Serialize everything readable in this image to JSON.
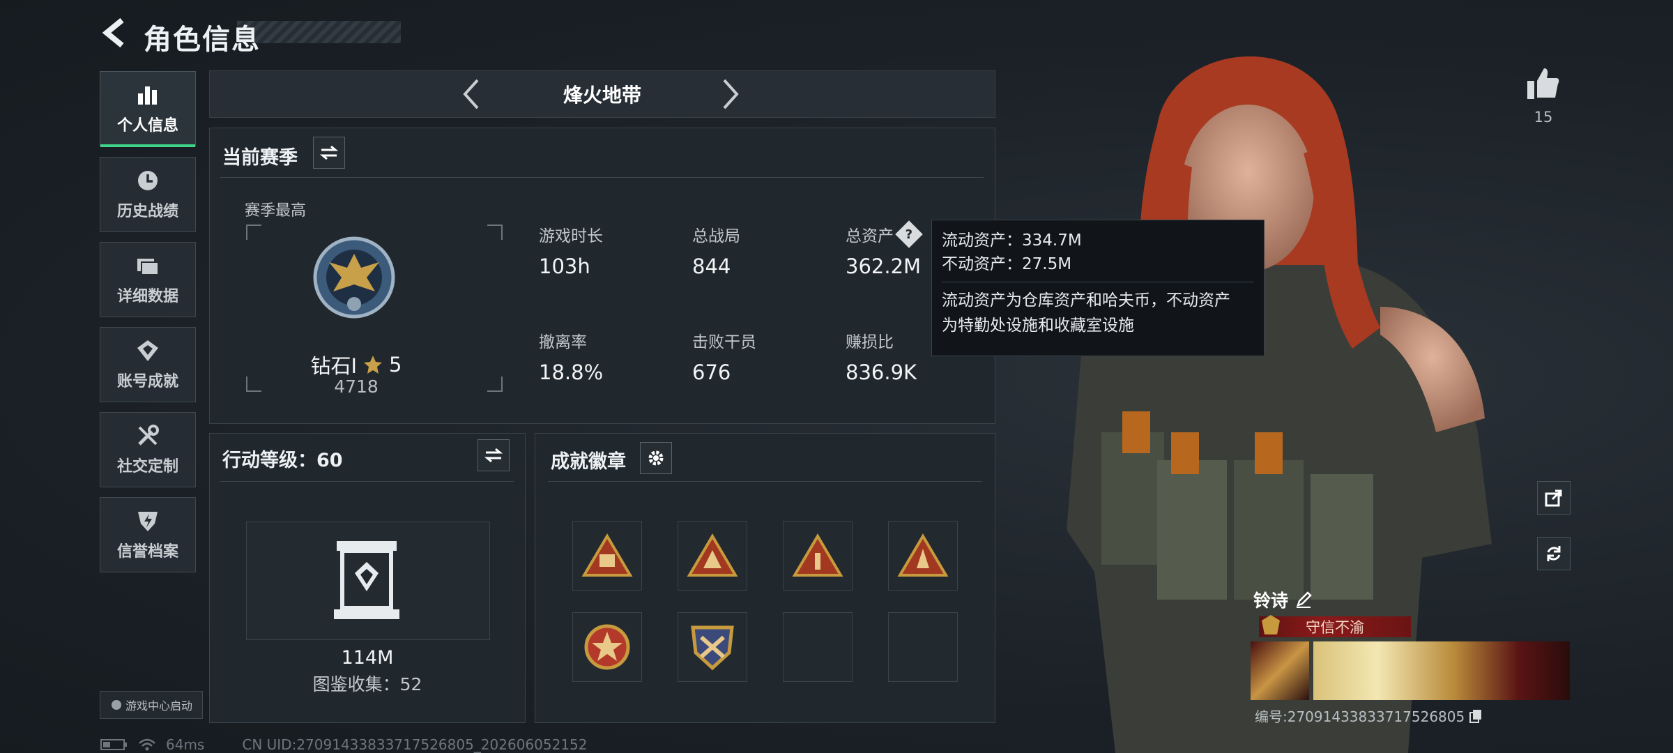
{
  "header": {
    "title": "角色信息"
  },
  "sidebar": {
    "items": [
      {
        "label": "个人信息",
        "icon": "bar-chart-icon",
        "active": true
      },
      {
        "label": "历史战绩",
        "icon": "history-clock-icon",
        "active": false
      },
      {
        "label": "详细数据",
        "icon": "folder-icon",
        "active": false
      },
      {
        "label": "账号成就",
        "icon": "trophy-icon",
        "active": false
      },
      {
        "label": "社交定制",
        "icon": "wrench-icon",
        "active": false
      },
      {
        "label": "信誉档案",
        "icon": "shield-icon",
        "active": false
      }
    ],
    "game_center_label": "游戏中心启动"
  },
  "mode": {
    "title": "烽火地带"
  },
  "season": {
    "title": "当前赛季",
    "best_label": "赛季最高",
    "rank_name": "钻石I",
    "rank_stars": "5",
    "rank_points": "4718",
    "stats": [
      {
        "label": "游戏时长",
        "value": "103h"
      },
      {
        "label": "总战局",
        "value": "844"
      },
      {
        "label": "总资产",
        "value": "362.2M"
      },
      {
        "label": "撤离率",
        "value": "18.8%"
      },
      {
        "label": "击败干员",
        "value": "676"
      },
      {
        "label": "赚损比",
        "value": "836.9K"
      }
    ]
  },
  "tooltip": {
    "liquid": "流动资产：334.7M",
    "fixed": "不动资产：27.5M",
    "desc_line1": "流动资产为仓库资产和哈夫币，不动资产",
    "desc_line2": "为特勤处设施和收藏室设施"
  },
  "action_level": {
    "title": "行动等级：60",
    "value": "114M",
    "collection": "图鉴收集：52"
  },
  "achievements": {
    "title": "成就徽章",
    "badge_count": 6,
    "slot_count": 8
  },
  "character": {
    "likes": "15",
    "name": "铃诗",
    "honor_title": "守信不渝",
    "id_text": "编号:2709143383371752680​5"
  },
  "status_bar": {
    "ping": "64ms",
    "uid": "CN UID:270914338337175268​05_202606052152"
  },
  "colors": {
    "accent_green": "#3fd48a",
    "title_red": "#8b1a1a",
    "badge_gold": "#c79a3e"
  }
}
